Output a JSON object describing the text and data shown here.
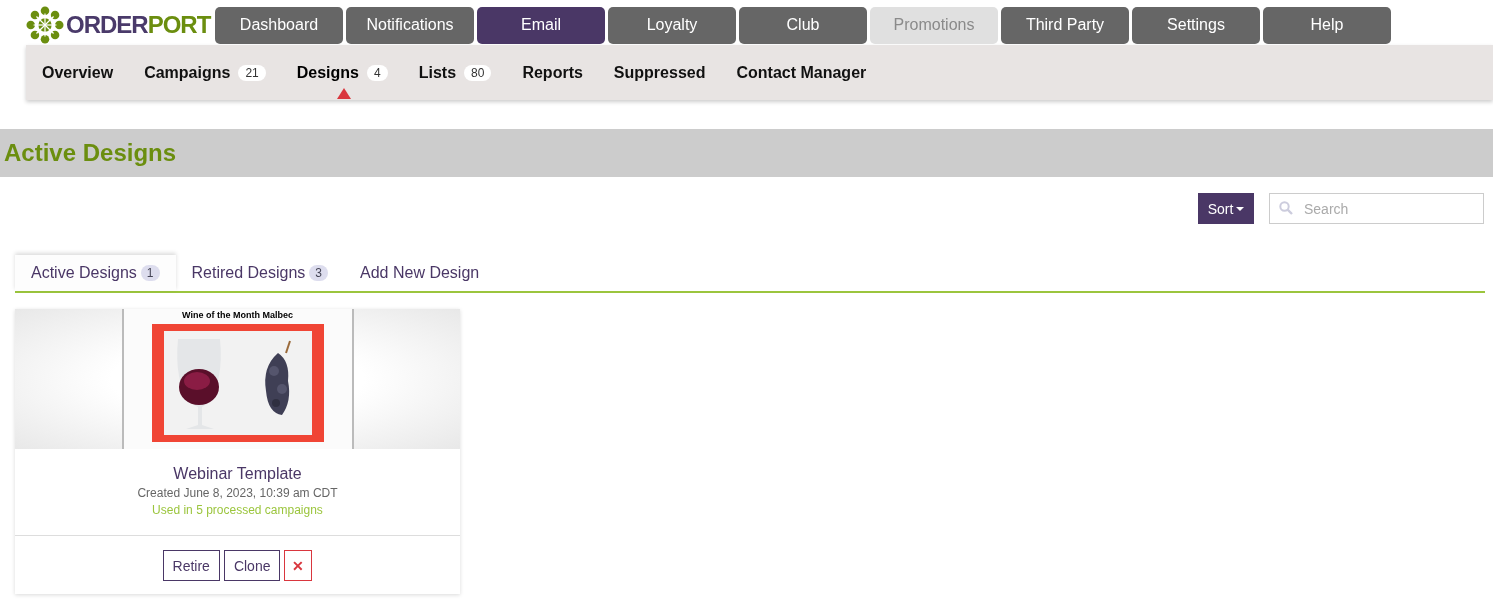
{
  "logo": {
    "part_1": "ORDER",
    "part_2": "PORT"
  },
  "main_nav": [
    {
      "label": "Dashboard",
      "selected": false,
      "disabled": false
    },
    {
      "label": "Notifications",
      "selected": false,
      "disabled": false
    },
    {
      "label": "Email",
      "selected": true,
      "disabled": false
    },
    {
      "label": "Loyalty",
      "selected": false,
      "disabled": false
    },
    {
      "label": "Club",
      "selected": false,
      "disabled": false
    },
    {
      "label": "Promotions",
      "selected": false,
      "disabled": true
    },
    {
      "label": "Third Party",
      "selected": false,
      "disabled": false
    },
    {
      "label": "Settings",
      "selected": false,
      "disabled": false
    },
    {
      "label": "Help",
      "selected": false,
      "disabled": false
    }
  ],
  "sub_nav": [
    {
      "label": "Overview",
      "selected": false
    },
    {
      "label": "Campaigns",
      "count": "21",
      "selected": false
    },
    {
      "label": "Designs",
      "count": "4",
      "selected": true
    },
    {
      "label": "Lists",
      "count": "80",
      "selected": false
    },
    {
      "label": "Reports",
      "selected": false
    },
    {
      "label": "Suppressed",
      "selected": false
    },
    {
      "label": "Contact Manager",
      "selected": false
    }
  ],
  "page_title": "Active Designs",
  "toolbar": {
    "sort_label": "Sort",
    "search": {
      "placeholder": "Search"
    }
  },
  "tabs": [
    {
      "label": "Active Designs",
      "count": "1",
      "selected": true
    },
    {
      "label": "Retired Designs",
      "count": "3",
      "selected": false
    },
    {
      "label": "Add New Design",
      "selected": false
    }
  ],
  "designs": [
    {
      "thumbnail_title": "Wine of the Month Malbec",
      "name": "Webinar Template",
      "created": "Created June 8, 2023, 10:39 am CDT",
      "usage": "Used in 5 processed campaigns",
      "buttons": [
        {
          "kind": "retire",
          "label": "Retire"
        },
        {
          "kind": "clone",
          "label": "Clone"
        },
        {
          "kind": "delete",
          "label": "✕"
        }
      ]
    }
  ]
}
